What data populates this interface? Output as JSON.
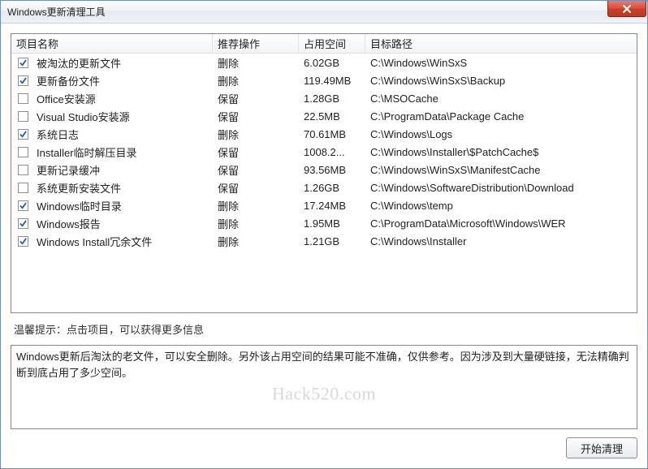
{
  "window": {
    "title": "Windows更新清理工具"
  },
  "columns": {
    "name": "项目名称",
    "action": "推荐操作",
    "size": "占用空间",
    "path": "目标路径"
  },
  "rows": [
    {
      "checked": true,
      "name": "被淘汰的更新文件",
      "action": "删除",
      "size": "6.02GB",
      "path": "C:\\Windows\\WinSxS"
    },
    {
      "checked": true,
      "name": "更新备份文件",
      "action": "删除",
      "size": "119.49MB",
      "path": "C:\\Windows\\WinSxS\\Backup"
    },
    {
      "checked": false,
      "name": "Office安装源",
      "action": "保留",
      "size": "1.28GB",
      "path": "C:\\MSOCache"
    },
    {
      "checked": false,
      "name": "Visual Studio安装源",
      "action": "保留",
      "size": "22.5MB",
      "path": "C:\\ProgramData\\Package Cache"
    },
    {
      "checked": true,
      "name": "系统日志",
      "action": "删除",
      "size": "70.61MB",
      "path": "C:\\Windows\\Logs"
    },
    {
      "checked": false,
      "name": "Installer临时解压目录",
      "action": "保留",
      "size": "1008.2...",
      "path": "C:\\Windows\\Installer\\$PatchCache$"
    },
    {
      "checked": false,
      "name": "更新记录缓冲",
      "action": "保留",
      "size": "93.56MB",
      "path": "C:\\Windows\\WinSxS\\ManifestCache"
    },
    {
      "checked": false,
      "name": "系统更新安装文件",
      "action": "保留",
      "size": "1.26GB",
      "path": "C:\\Windows\\SoftwareDistribution\\Download"
    },
    {
      "checked": true,
      "name": "Windows临时目录",
      "action": "删除",
      "size": "17.24MB",
      "path": "C:\\Windows\\temp"
    },
    {
      "checked": true,
      "name": "Windows报告",
      "action": "删除",
      "size": "1.95MB",
      "path": "C:\\ProgramData\\Microsoft\\Windows\\WER"
    },
    {
      "checked": true,
      "name": "Windows Install冗余文件",
      "action": "删除",
      "size": "1.21GB",
      "path": "C:\\Windows\\Installer"
    }
  ],
  "hint": "温馨提示：点击项目，可以获得更多信息",
  "description": "Windows更新后淘汰的老文件，可以安全删除。另外该占用空间的结果可能不准确，仅供参考。因为涉及到大量硬链接，无法精确判断到底占用了多少空间。",
  "watermark": "Hack520.com",
  "buttons": {
    "start": "开始清理"
  }
}
